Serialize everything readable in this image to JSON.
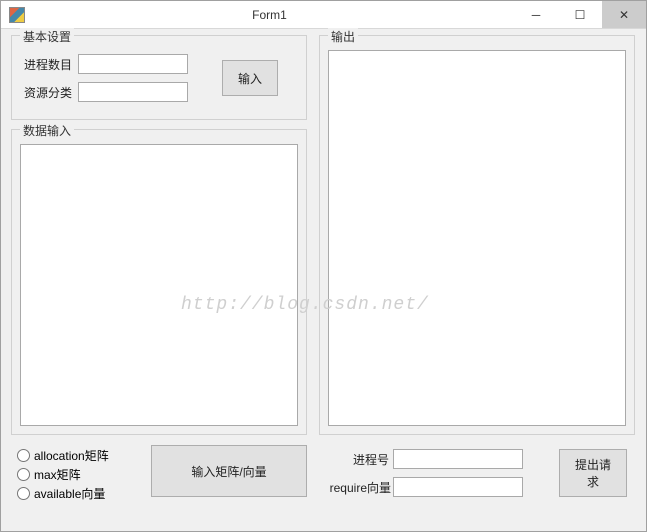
{
  "window": {
    "title": "Form1"
  },
  "basic": {
    "legend": "基本设置",
    "process_count_label": "进程数目",
    "process_count_value": "",
    "resource_class_label": "资源分类",
    "resource_class_value": "",
    "input_button": "输入"
  },
  "datain": {
    "legend": "数据输入"
  },
  "output": {
    "legend": "输出"
  },
  "radios": {
    "allocation": "allocation矩阵",
    "max": "max矩阵",
    "available": "available向量"
  },
  "matrix_button": "输入矩阵/向量",
  "request": {
    "process_id_label": "进程号",
    "process_id_value": "",
    "require_label": "require向量",
    "require_value": "",
    "submit_button": "提出请求"
  },
  "watermark": "http://blog.csdn.net/"
}
